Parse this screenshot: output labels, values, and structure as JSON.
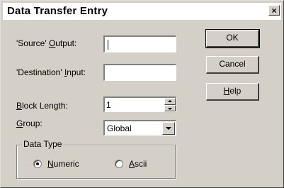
{
  "window": {
    "title": "Data Transfer Entry",
    "close_glyph": "×"
  },
  "fields": {
    "source_output": {
      "label_pre": "'Source' ",
      "label_key": "O",
      "label_post": "utput:",
      "value": ""
    },
    "destination_input": {
      "label_pre": "'Destination' ",
      "label_key": "I",
      "label_post": "nput:",
      "value": ""
    },
    "block_length": {
      "label_key": "B",
      "label_post": "lock Length:",
      "value": "1"
    },
    "group": {
      "label_key": "G",
      "label_post": "roup:",
      "value": "Global"
    }
  },
  "buttons": {
    "ok": "OK",
    "cancel": "Cancel",
    "help_key": "H",
    "help_post": "elp"
  },
  "data_type": {
    "legend": "Data Type",
    "options": [
      {
        "key": "N",
        "post": "umeric",
        "selected": true
      },
      {
        "key": "A",
        "post": "scii",
        "selected": false
      }
    ]
  }
}
